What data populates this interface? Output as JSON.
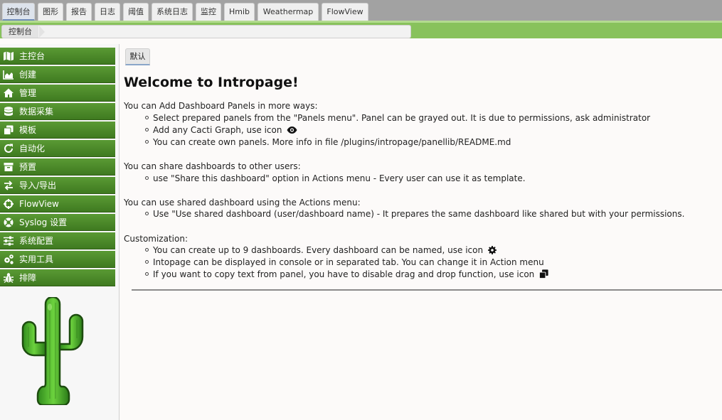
{
  "tabs": [
    {
      "label": "控制台",
      "active": true
    },
    {
      "label": "图形"
    },
    {
      "label": "报告"
    },
    {
      "label": "日志"
    },
    {
      "label": "阈值"
    },
    {
      "label": "系统日志"
    },
    {
      "label": "监控"
    },
    {
      "label": "Hmib"
    },
    {
      "label": "Weathermap"
    },
    {
      "label": "FlowView"
    }
  ],
  "breadcrumb": {
    "item": "控制台"
  },
  "sidebar": {
    "items": [
      {
        "label": "主控台",
        "icon": "map-icon"
      },
      {
        "label": "创建",
        "icon": "area-chart-icon"
      },
      {
        "label": "管理",
        "icon": "home-icon"
      },
      {
        "label": "数据采集",
        "icon": "database-icon"
      },
      {
        "label": "模板",
        "icon": "copy-icon"
      },
      {
        "label": "自动化",
        "icon": "refresh-icon"
      },
      {
        "label": "预置",
        "icon": "archive-icon"
      },
      {
        "label": "导入/导出",
        "icon": "exchange-icon"
      },
      {
        "label": "FlowView",
        "icon": "crosshairs-icon"
      },
      {
        "label": "Syslog 设置",
        "icon": "life-ring-icon"
      },
      {
        "label": "系统配置",
        "icon": "sliders-icon"
      },
      {
        "label": "实用工具",
        "icon": "cogs-icon"
      },
      {
        "label": "排障",
        "icon": "bug-icon"
      }
    ]
  },
  "main": {
    "dashboard_tab": "默认",
    "title": "Welcome to Intropage!",
    "sections": [
      {
        "heading": "You can Add Dashboard Panels in more ways:",
        "bullets": [
          "Select prepared panels from the \"Panels menu\". Panel can be grayed out. It is due to permissions, ask administrator",
          "Add any Cacti Graph, use icon",
          "You can create own panels. More info in file /plugins/intropage/panellib/README.md"
        ]
      },
      {
        "heading": "You can share dashboards to other users:",
        "bullets": [
          "use \"Share this dashboard\" option in Actions menu - Every user can use it as template."
        ]
      },
      {
        "heading": "You can use shared dashboard using the Actions menu:",
        "bullets": [
          "Use \"Use shared dashboard (user/dashboard name) - It prepares the same dashboard like shared but with your permissions."
        ]
      },
      {
        "heading": "Customization:",
        "bullets": [
          "You can create up to 9 dashboards. Every dashboard can be named, use icon",
          "Intopage can be displayed in console or in separated tab. You can change it in Action menu",
          "If you want to copy text from panel, you have to disable drag and drop function, use icon"
        ]
      }
    ]
  }
}
